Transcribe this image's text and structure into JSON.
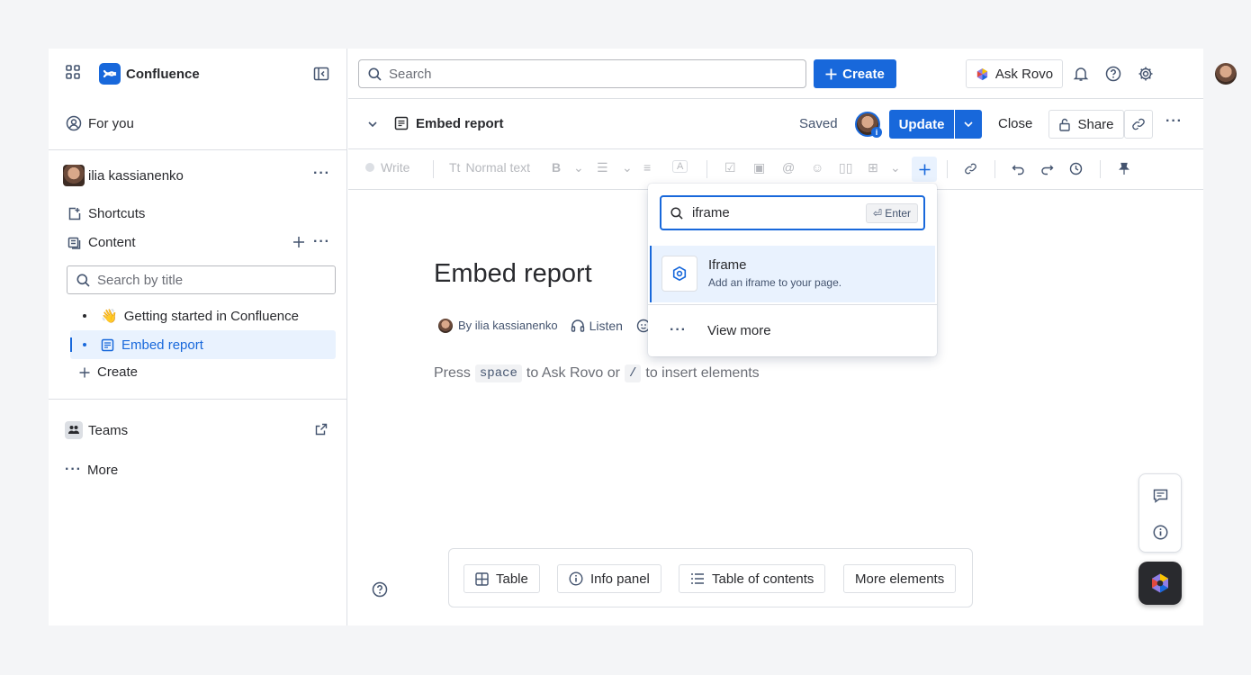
{
  "sidebar": {
    "app_name": "Confluence",
    "for_you": "For you",
    "user_name": "ilia kassianenko",
    "shortcuts": "Shortcuts",
    "content": "Content",
    "search_placeholder": "Search by title",
    "pages": [
      {
        "emoji": "👋",
        "title": "Getting started in Confluence",
        "selected": false
      },
      {
        "title": "Embed report",
        "selected": true
      }
    ],
    "create": "Create",
    "teams": "Teams",
    "more": "More"
  },
  "topbar": {
    "search_placeholder": "Search",
    "create_label": "Create",
    "ask_rovo_label": "Ask Rovo"
  },
  "page_header": {
    "title": "Embed report",
    "status": "Saved",
    "update_label": "Update",
    "close_label": "Close",
    "share_label": "Share"
  },
  "toolbar": {
    "write_label": "Write",
    "text_style": "Normal text"
  },
  "page": {
    "title": "Embed report",
    "byline": "By ilia kassianenko",
    "listen_label": "Listen",
    "hint_prefix": "Press",
    "hint_key1": "space",
    "hint_middle": "to Ask Rovo or",
    "hint_key2": "/",
    "hint_suffix": "to insert elements"
  },
  "bottom_elements": {
    "table": "Table",
    "info_panel": "Info panel",
    "toc": "Table of contents",
    "more": "More elements"
  },
  "insert_popup": {
    "query": "iframe",
    "enter_hint": "⏎ Enter",
    "result_title": "Iframe",
    "result_desc": "Add an iframe to your page.",
    "view_more": "View more"
  },
  "colors": {
    "primary": "#1868db",
    "selected_bg": "#e9f2fe",
    "border": "#dcdfe4"
  }
}
